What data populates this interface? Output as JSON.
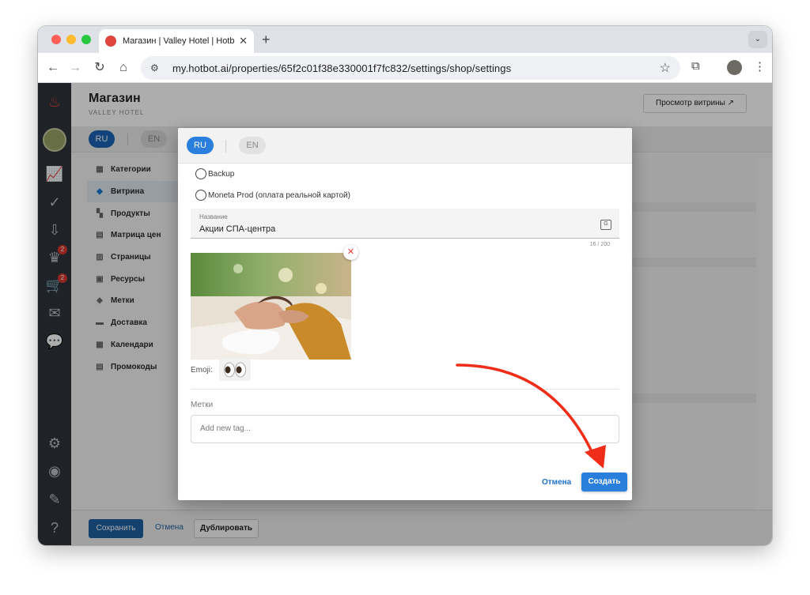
{
  "browser": {
    "tab_title": "Магазин | Valley Hotel | Hotb",
    "tab_close": "✕",
    "new_tab": "+",
    "url": "my.hotbot.ai/properties/65f2c01f38e330001f7fc832/settings/shop/settings",
    "tab_menu": "⌄"
  },
  "header": {
    "title": "Магазин",
    "subtitle": "VALLEY HOTEL",
    "preview_button": "Просмотр витрины ↗"
  },
  "languages": {
    "ru": "RU",
    "en": "EN"
  },
  "nav": {
    "items": [
      {
        "label": "Категории",
        "icon": "store-icon"
      },
      {
        "label": "Витрина",
        "icon": "showcase-icon"
      },
      {
        "label": "Продукты",
        "icon": "grid-icon"
      },
      {
        "label": "Матрица цен",
        "icon": "price-matrix-icon"
      },
      {
        "label": "Страницы",
        "icon": "page-icon"
      },
      {
        "label": "Ресурсы",
        "icon": "resources-icon"
      },
      {
        "label": "Метки",
        "icon": "tag-icon"
      },
      {
        "label": "Доставка",
        "icon": "truck-icon"
      },
      {
        "label": "Календари",
        "icon": "calendar-icon"
      },
      {
        "label": "Промокоды",
        "icon": "promo-icon"
      }
    ]
  },
  "sidebar": {
    "badge_tasks": "2",
    "badge_cart": "2"
  },
  "footer": {
    "save": "Сохранить",
    "cancel": "Отмена",
    "duplicate": "Дублировать"
  },
  "modal": {
    "lang_ru": "RU",
    "lang_en": "EN",
    "radio_backup": "Backup",
    "radio_moneta": "Moneta Prod (оплата реальной картой)",
    "name_label": "Название",
    "name_value": "Акции СПА-центра",
    "counter": "16 / 200",
    "emoji_label": "Emoji:",
    "emoji_value": "👀",
    "tags_label": "Метки",
    "tags_placeholder": "Add new tag...",
    "cancel": "Отмена",
    "create": "Создать"
  },
  "colors": {
    "accent": "#2a7fdc",
    "sidebar": "#2f343a",
    "arrow": "#f02d18"
  }
}
